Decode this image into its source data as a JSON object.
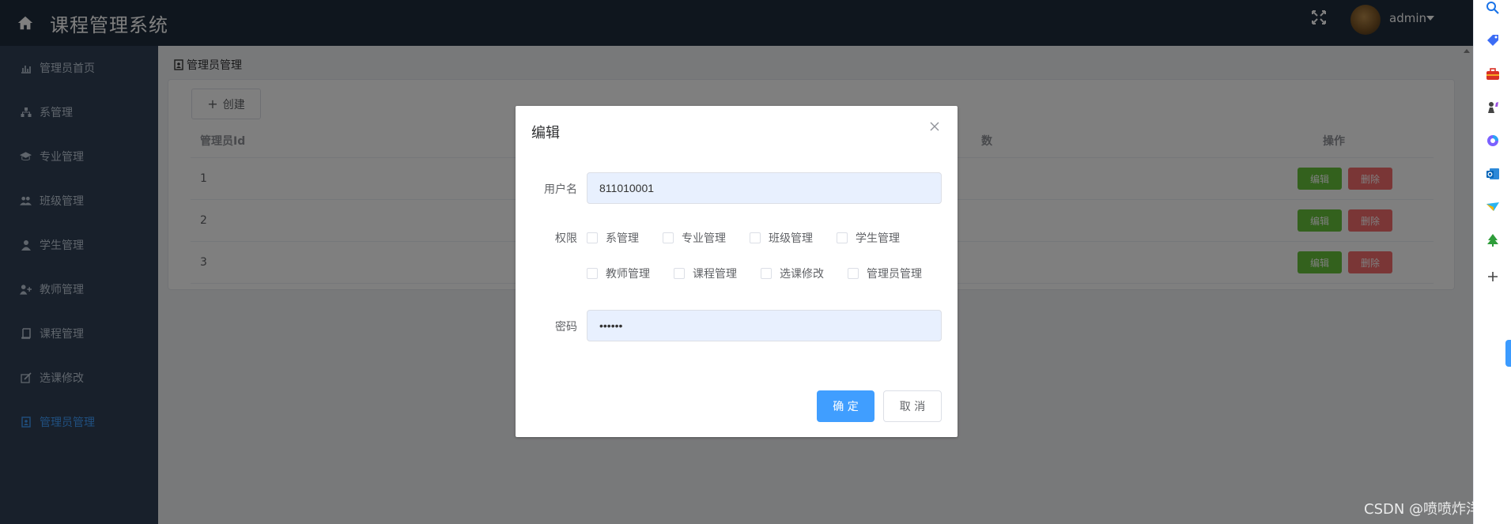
{
  "header": {
    "title": "课程管理系统",
    "user": "admin"
  },
  "sidebar": {
    "items": [
      {
        "label": "管理员首页",
        "icon": "bar-chart-icon"
      },
      {
        "label": "系管理",
        "icon": "sitemap-icon"
      },
      {
        "label": "专业管理",
        "icon": "graduation-cap-icon"
      },
      {
        "label": "班级管理",
        "icon": "users-icon"
      },
      {
        "label": "学生管理",
        "icon": "user-icon"
      },
      {
        "label": "教师管理",
        "icon": "user-plus-icon"
      },
      {
        "label": "课程管理",
        "icon": "book-icon"
      },
      {
        "label": "选课修改",
        "icon": "edit-icon"
      },
      {
        "label": "管理员管理",
        "icon": "admin-badge-icon",
        "active": true
      }
    ]
  },
  "main": {
    "breadcrumb": "管理员管理",
    "create_label": "创建",
    "table": {
      "headers": {
        "id": "管理员Id",
        "count": "数",
        "ops": "操作"
      },
      "rows": [
        {
          "id": "1",
          "edit": "编辑",
          "delete": "删除"
        },
        {
          "id": "2",
          "edit": "编辑",
          "delete": "删除"
        },
        {
          "id": "3",
          "edit": "编辑",
          "delete": "删除"
        }
      ]
    }
  },
  "dialog": {
    "title": "编辑",
    "username_label": "用户名",
    "username_value": "811010001",
    "permissions_label": "权限",
    "permissions": [
      "系管理",
      "专业管理",
      "班级管理",
      "学生管理",
      "教师管理",
      "课程管理",
      "选课修改",
      "管理员管理"
    ],
    "password_label": "密码",
    "password_value": "••••••",
    "ok_label": "确 定",
    "cancel_label": "取 消"
  },
  "watermark": "CSDN @喷喷炸洋芋",
  "colors": {
    "header": "#1f2d3d",
    "sidebar": "#304156",
    "primary": "#409eff",
    "success": "#67c23a",
    "danger": "#f56c6c"
  }
}
